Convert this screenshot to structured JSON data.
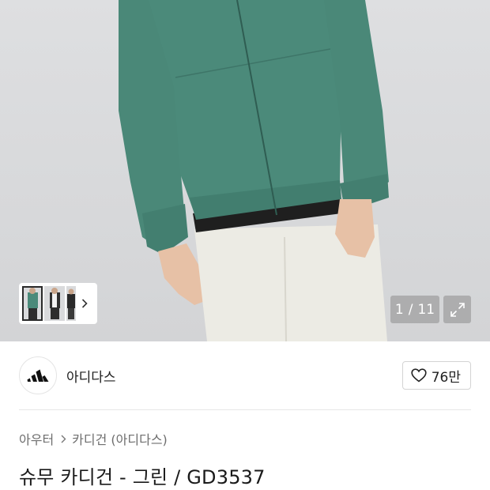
{
  "gallery": {
    "current": "1",
    "separator": "/",
    "total": "11",
    "jacket_color": "#4b8a7a",
    "pants_color": "#eceae3",
    "thumbnails": [
      {
        "name": "thumbnail-1",
        "selected": true
      },
      {
        "name": "thumbnail-2",
        "selected": false
      },
      {
        "name": "thumbnail-3",
        "selected": false
      }
    ],
    "next_icon": "chevron-right-icon",
    "expand_icon": "expand-icon"
  },
  "brand": {
    "name": "아디다스",
    "logo_icon": "adidas-logo-icon"
  },
  "like": {
    "icon": "heart-outline-icon",
    "count": "76만"
  },
  "breadcrumb": {
    "items": [
      "아우터",
      "카디건 (아디다스)"
    ],
    "separator_icon": "chevron-right-icon"
  },
  "product": {
    "title": "슈무 카디건 - 그린 / GD3537"
  }
}
